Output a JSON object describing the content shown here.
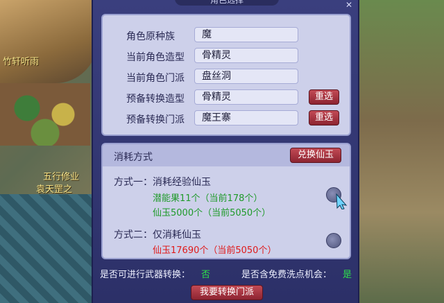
{
  "world": {
    "npc_name_1": "竹轩听雨",
    "npc_name_2": "五行修业",
    "npc_name_3": "袁天罡之"
  },
  "dialog": {
    "title": "角色选择",
    "fields": [
      {
        "label": "角色原种族",
        "value": "魔"
      },
      {
        "label": "当前角色造型",
        "value": "骨精灵"
      },
      {
        "label": "当前角色门派",
        "value": "盘丝洞"
      },
      {
        "label": "预备转换造型",
        "value": "骨精灵"
      },
      {
        "label": "预备转换门派",
        "value": "魔王寨"
      }
    ],
    "reselect_label": "重选",
    "cost": {
      "title": "消耗方式",
      "exchange_label": "兑换仙玉",
      "option1_label": "方式一：",
      "option1_desc": "消耗经验仙玉",
      "option1_line1": "潜能果11个（当前178个）",
      "option1_line2": "仙玉5000个（当前5050个）",
      "option2_label": "方式二：",
      "option2_desc": "仅消耗仙玉",
      "option2_line1": "仙玉17690个（当前5050个）"
    },
    "weapon_q": "是否可进行武器转换：",
    "weapon_a": "否",
    "free_q": "是否含免费洗点机会：",
    "free_a": "是",
    "confirm_label": "我要转换门派"
  },
  "colors": {
    "panel": "#cdd0ea",
    "button": "#a63440",
    "green": "#1f9a2a",
    "red": "#e01a1a"
  }
}
